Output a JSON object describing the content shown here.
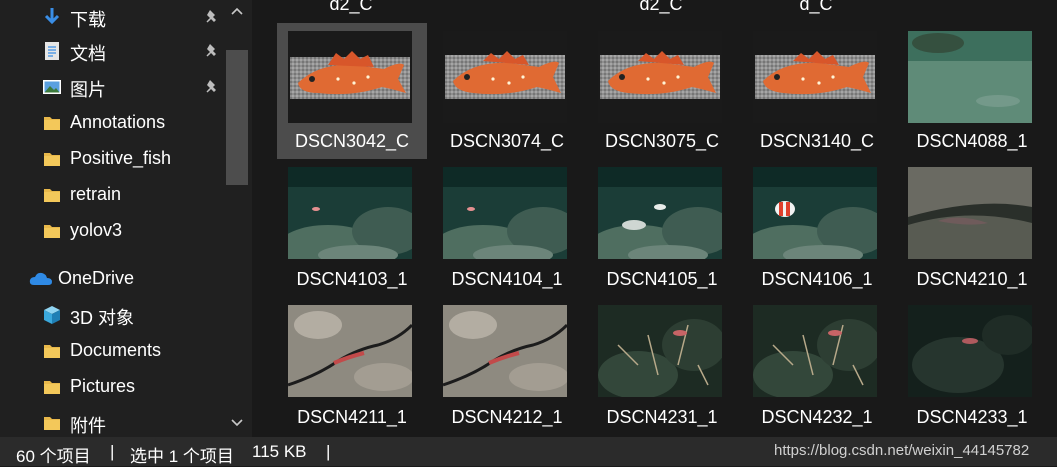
{
  "sidebar": {
    "items": [
      {
        "label": "下载",
        "icon": "download-arrow-icon",
        "pinned": true
      },
      {
        "label": "文档",
        "icon": "document-icon",
        "pinned": true
      },
      {
        "label": "图片",
        "icon": "pictures-icon",
        "pinned": true
      },
      {
        "label": "Annotations",
        "icon": "folder-icon",
        "pinned": false
      },
      {
        "label": "Positive_fish",
        "icon": "folder-icon",
        "pinned": false
      },
      {
        "label": "retrain",
        "icon": "folder-icon",
        "pinned": false
      },
      {
        "label": "yolov3",
        "icon": "folder-icon",
        "pinned": false
      },
      {
        "label": "OneDrive",
        "icon": "onedrive-cloud-icon",
        "pinned": false
      },
      {
        "label": "3D 对象",
        "icon": "3d-objects-icon",
        "pinned": false
      },
      {
        "label": "Documents",
        "icon": "folder-icon",
        "pinned": false
      },
      {
        "label": "Pictures",
        "icon": "folder-icon",
        "pinned": false
      },
      {
        "label": "附件",
        "icon": "folder-icon",
        "pinned": false
      }
    ]
  },
  "files": {
    "previous_row_labels": [
      "d2_C",
      "d2_C",
      "d_C"
    ],
    "items": [
      {
        "name": "DSCN3042_C",
        "kind": "fish-crop-slim",
        "selected": true
      },
      {
        "name": "DSCN3074_C",
        "kind": "fish-crop"
      },
      {
        "name": "DSCN3075_C",
        "kind": "fish-crop"
      },
      {
        "name": "DSCN3140_C",
        "kind": "fish-crop"
      },
      {
        "name": "DSCN4088_1",
        "kind": "seafloor-sand"
      },
      {
        "name": "DSCN4103_1",
        "kind": "seafloor-rock"
      },
      {
        "name": "DSCN4104_1",
        "kind": "seafloor-rock"
      },
      {
        "name": "DSCN4105_1",
        "kind": "seafloor-fish"
      },
      {
        "name": "DSCN4106_1",
        "kind": "seafloor-clownfish"
      },
      {
        "name": "DSCN4210_1",
        "kind": "seafloor-ledge"
      },
      {
        "name": "DSCN4211_1",
        "kind": "rock-crack"
      },
      {
        "name": "DSCN4212_1",
        "kind": "rock-crack"
      },
      {
        "name": "DSCN4231_1",
        "kind": "seafloor-anemone"
      },
      {
        "name": "DSCN4232_1",
        "kind": "seafloor-anemone"
      },
      {
        "name": "DSCN4233_1",
        "kind": "seafloor-dark"
      }
    ]
  },
  "status": {
    "item_count": "60 个项目",
    "sep1": "|",
    "selected": "选中 1 个项目",
    "size": "115 KB",
    "sep2": "|",
    "watermark": "https://blog.csdn.net/weixin_44145782"
  },
  "colors": {
    "sidebar_bg": "#202020",
    "content_bg": "#191919",
    "selected_bg": "#4c4c4c",
    "folder": "#e8b84a",
    "accent_blue": "#3a8ee6"
  }
}
